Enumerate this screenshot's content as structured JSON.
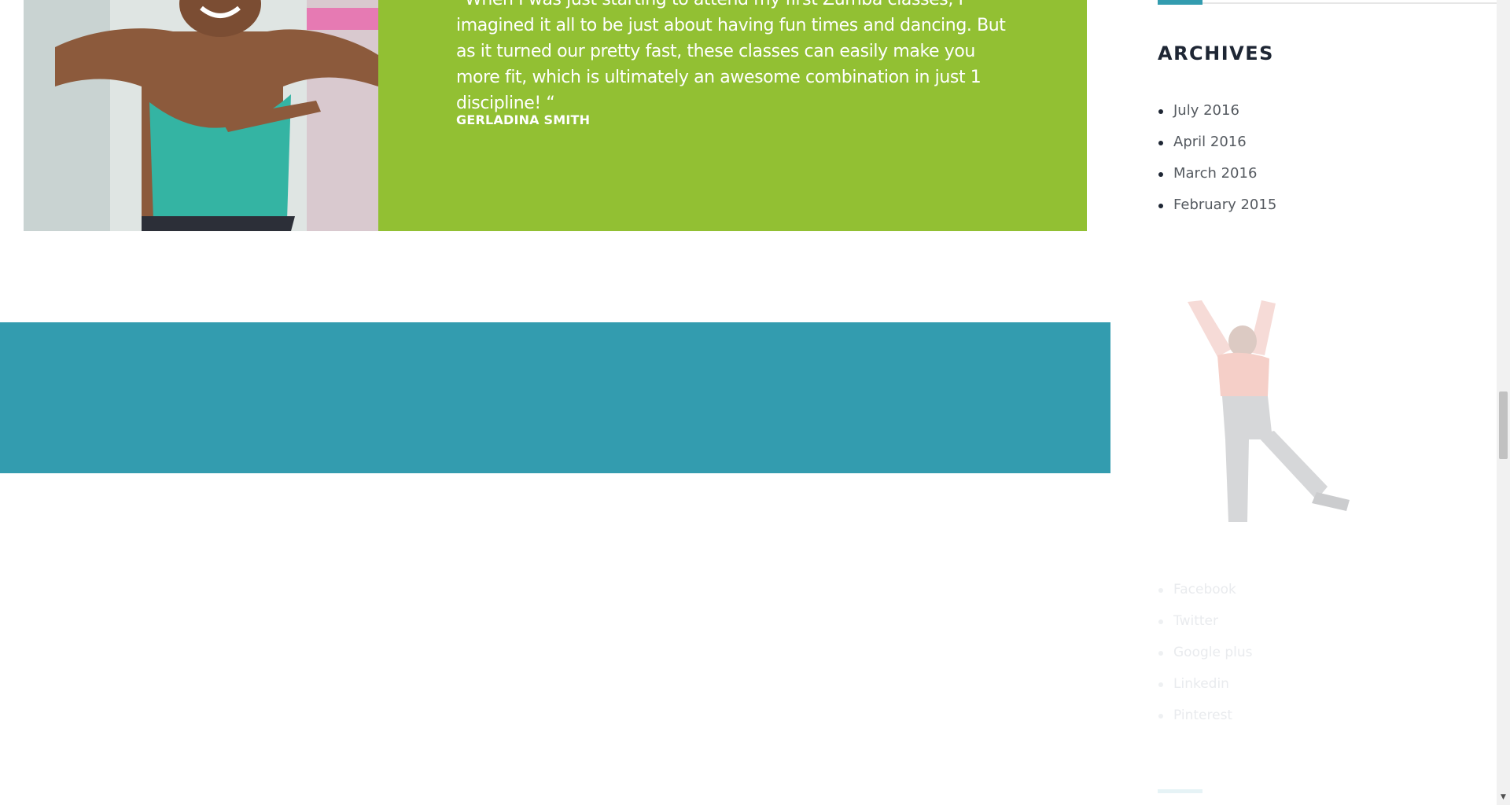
{
  "testimonial": {
    "quote": "“When I was just starting to attend my first Zumba classes, I imagined it all to be just about having fun times and dancing. But as it turned our pretty fast, these classes can easily make you more fit, which is ultimately an awesome combination in just 1 discipline! “",
    "author": "GERLADINA SMITH"
  },
  "sidebar": {
    "archives_title": "ARCHIVES",
    "archives": [
      "July 2016",
      "April 2016",
      "March 2016",
      "February 2015"
    ],
    "social": [
      "Facebook",
      "Twitter",
      "Google plus",
      "Linkedin",
      "Pinterest"
    ]
  },
  "colors": {
    "testimonial_green": "#92c033",
    "band_teal": "#339caf",
    "heading_dark": "#1e2634",
    "body_text": "#555a60"
  },
  "icons": {
    "scroll_down": "triangle-down"
  }
}
